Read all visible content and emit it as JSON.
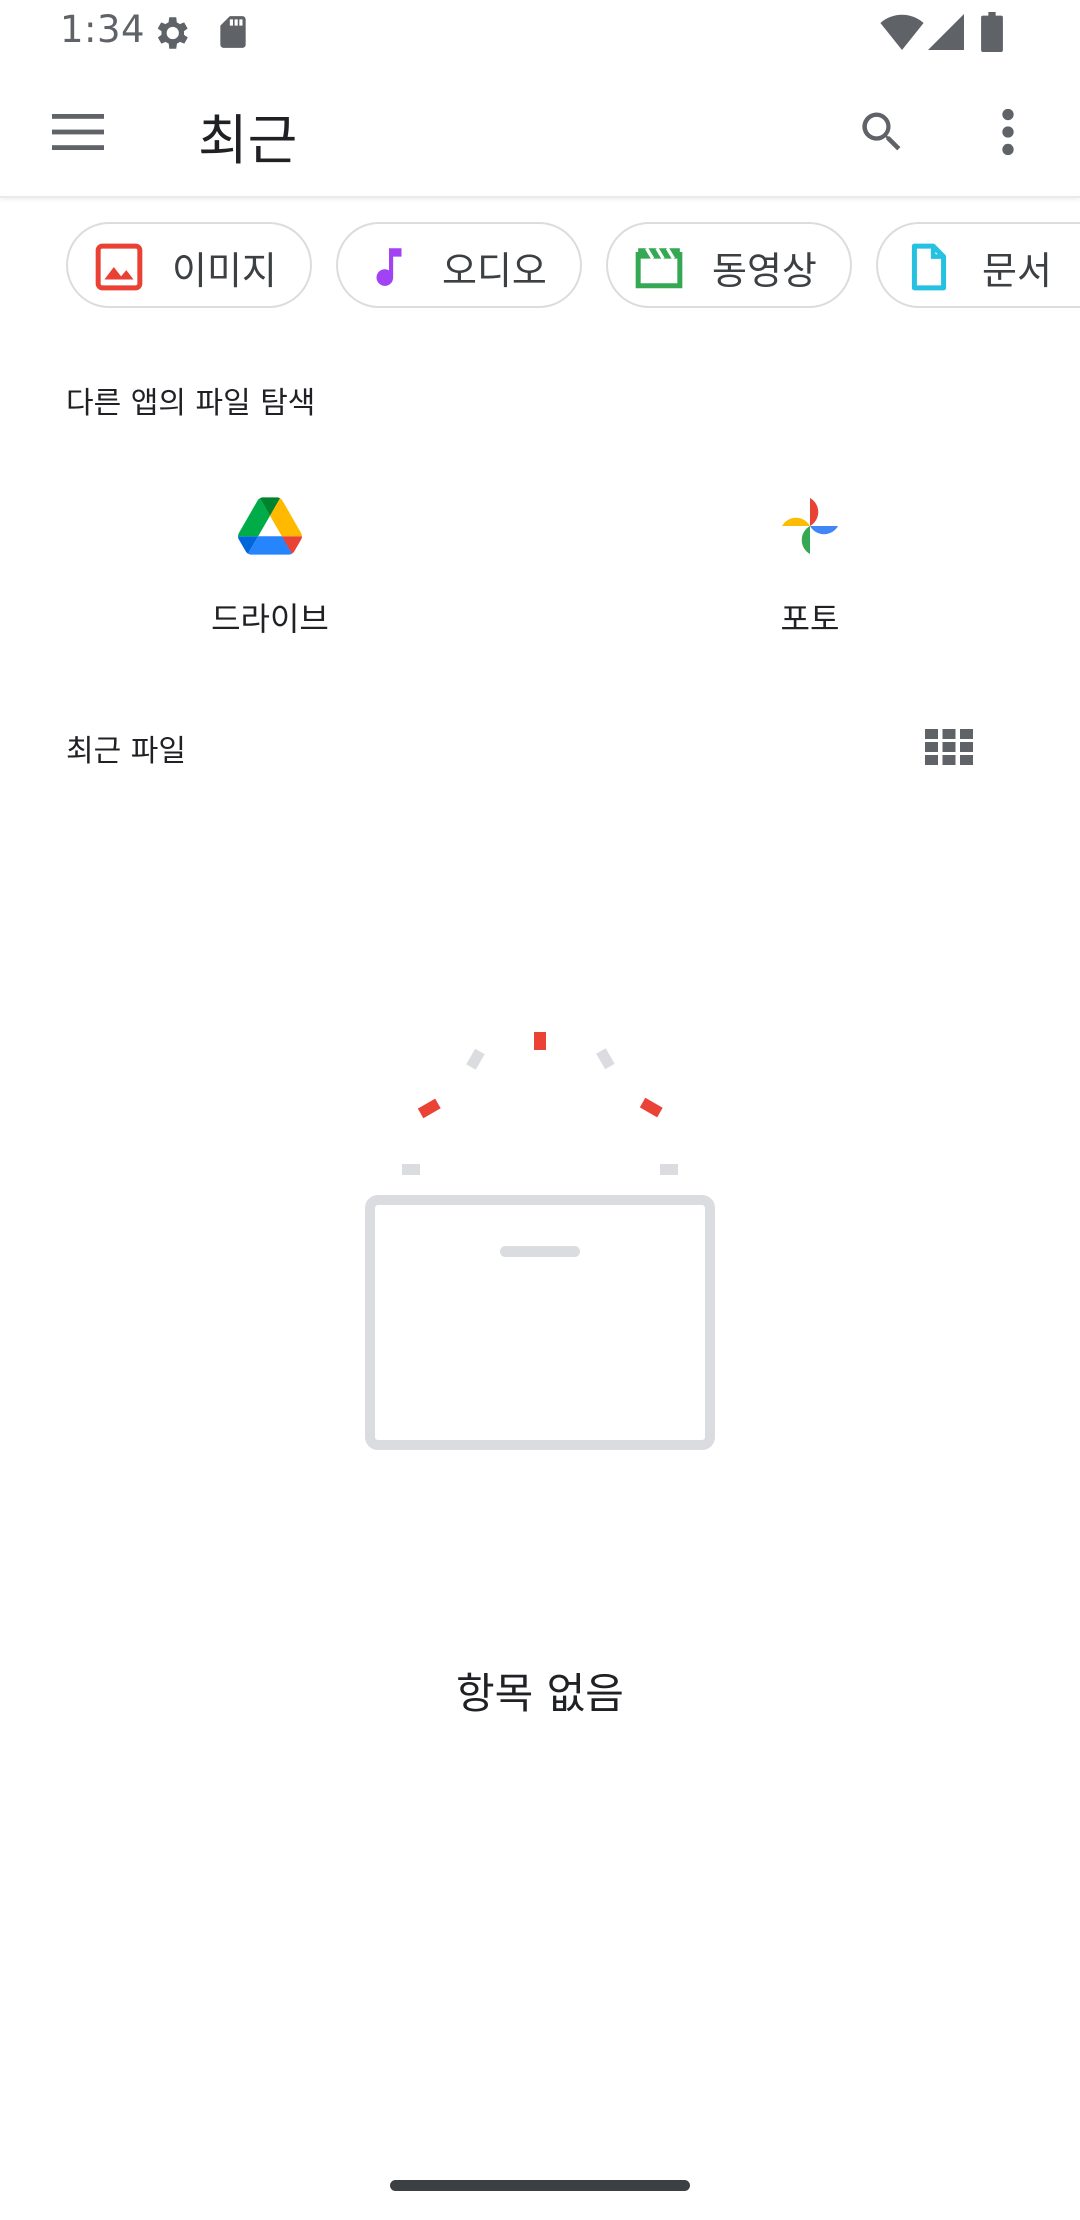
{
  "status_bar": {
    "time": "1:34",
    "icons": [
      "settings-gear-icon",
      "sd-card-icon",
      "wifi-icon",
      "cellular-signal-icon",
      "battery-icon"
    ]
  },
  "app_bar": {
    "title": "최근",
    "menu_icon": "hamburger-menu-icon",
    "search_icon": "search-icon",
    "more_icon": "more-vert-icon"
  },
  "filter_chips": [
    {
      "label": "이미지",
      "icon": "image-icon",
      "color": "#e94235"
    },
    {
      "label": "오디오",
      "icon": "music-note-icon",
      "color": "#a142f4"
    },
    {
      "label": "동영상",
      "icon": "video-clapper-icon",
      "color": "#34a853"
    },
    {
      "label": "문서",
      "icon": "document-icon",
      "color": "#24c1e0"
    }
  ],
  "other_apps": {
    "title": "다른 앱의 파일 탐색",
    "apps": [
      {
        "label": "드라이브",
        "icon": "google-drive-icon"
      },
      {
        "label": "포토",
        "icon": "google-photos-icon"
      }
    ]
  },
  "recent_files": {
    "title": "최근 파일",
    "view_toggle_icon": "grid-view-icon",
    "empty_text": "항목 없음"
  }
}
